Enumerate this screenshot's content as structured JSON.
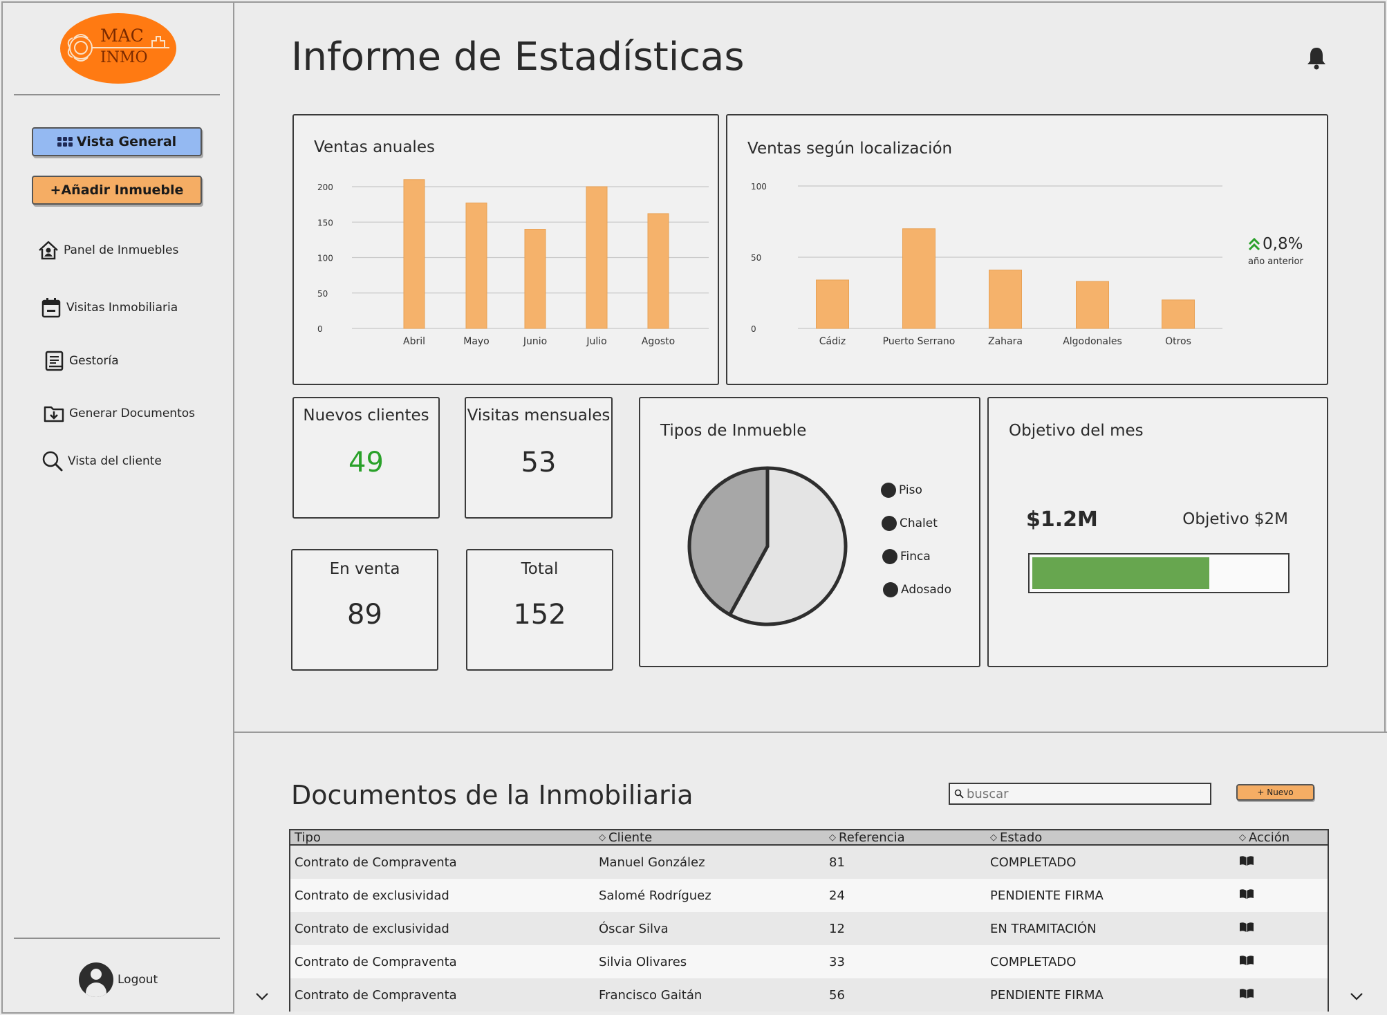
{
  "app": {
    "logo_line1": "MAC",
    "logo_line2": "INMO",
    "brand_color": "#ff7a12"
  },
  "sidebar": {
    "overview_label": "Vista General",
    "add_label": "+Añadir Inmueble",
    "items": [
      {
        "label": "Panel de Inmuebles",
        "icon": "home-user-icon"
      },
      {
        "label": "Visitas Inmobiliaria",
        "icon": "calendar-icon"
      },
      {
        "label": "Gestoría",
        "icon": "notebook-icon"
      },
      {
        "label": "Generar Documentos",
        "icon": "folder-download-icon"
      },
      {
        "label": "Vista del cliente",
        "icon": "search-icon"
      }
    ],
    "logout_label": "Logout"
  },
  "header": {
    "title": "Informe de Estadísticas"
  },
  "annual_sales": {
    "title": "Ventas anuales"
  },
  "location_sales": {
    "title": "Ventas según localización",
    "change": "0,8%",
    "change_note": "año anterior",
    "change_color": "#2aa12a"
  },
  "stats": {
    "new_clients": {
      "label": "Nuevos clientes",
      "value": "49",
      "color": "#2aa12a"
    },
    "monthly_visits": {
      "label": "Visitas mensuales",
      "value": "53"
    },
    "for_sale": {
      "label": "En venta",
      "value": "89"
    },
    "total": {
      "label": "Total",
      "value": "152"
    }
  },
  "property_types": {
    "title": "Tipos de Inmueble",
    "legend": [
      "Piso",
      "Chalet",
      "Finca",
      "Adosado"
    ]
  },
  "goal": {
    "title": "Objetivo del mes",
    "current": "$1.2M",
    "target": "Objetivo $2M",
    "progress": 0.7,
    "bar_color": "#67a64f"
  },
  "documents": {
    "title": "Documentos de la Inmobiliaria",
    "search_placeholder": "buscar",
    "new_label": "+ Nuevo",
    "columns": [
      "Tipo",
      "Cliente",
      "Referencia",
      "Estado",
      "Acción"
    ],
    "rows": [
      {
        "tipo": "Contrato de Compraventa",
        "cliente": "Manuel González",
        "referencia": "81",
        "estado": "COMPLETADO"
      },
      {
        "tipo": "Contrato de exclusividad",
        "cliente": "Salomé Rodríguez",
        "referencia": "24",
        "estado": "PENDIENTE FIRMA"
      },
      {
        "tipo": "Contrato de exclusividad",
        "cliente": "Óscar Silva",
        "referencia": "12",
        "estado": "EN TRAMITACIÓN"
      },
      {
        "tipo": "Contrato de Compraventa",
        "cliente": "Silvia Olivares",
        "referencia": "33",
        "estado": "COMPLETADO"
      },
      {
        "tipo": "Contrato de Compraventa",
        "cliente": "Francisco Gaitán",
        "referencia": "56",
        "estado": "PENDIENTE FIRMA"
      }
    ],
    "action_icon": "book-icon"
  },
  "chart_data": [
    {
      "type": "bar",
      "title": "Ventas anuales",
      "categories": [
        "Abril",
        "Mayo",
        "Junio",
        "Julio",
        "Agosto"
      ],
      "values": [
        210,
        177,
        140,
        200,
        162
      ],
      "ylim": [
        0,
        200
      ],
      "yticks": [
        0,
        50,
        100,
        150,
        200
      ],
      "grid": true,
      "bar_color": "#f5b26b"
    },
    {
      "type": "bar",
      "title": "Ventas según localización",
      "categories": [
        "Cádiz",
        "Puerto Serrano",
        "Zahara",
        "Algodonales",
        "Otros"
      ],
      "values": [
        34,
        70,
        41,
        33,
        20
      ],
      "ylim": [
        0,
        100
      ],
      "yticks": [
        0,
        50,
        100
      ],
      "grid": true,
      "bar_color": "#f5b26b"
    },
    {
      "type": "pie",
      "title": "Tipos de Inmueble",
      "slices": [
        {
          "label": "Piso",
          "value": 58,
          "color": "#e4e4e4"
        },
        {
          "label": "Chalet",
          "value": 42,
          "color": "#a7a7a7"
        }
      ]
    }
  ]
}
